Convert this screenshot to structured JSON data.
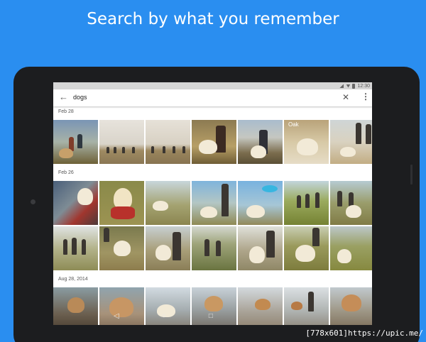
{
  "banner": {
    "title": "Search by what you remember"
  },
  "status_bar": {
    "time": "12:30",
    "icons": [
      "signal-icon",
      "wifi-icon",
      "battery-icon"
    ]
  },
  "search": {
    "query": "dogs",
    "back_icon": "arrow-back-icon",
    "clear_icon": "close-icon",
    "menu_icon": "more-vert-icon"
  },
  "sections": [
    {
      "date": "Feb 28",
      "photos": [
        "hikers-with-dog",
        "group-on-hillside",
        "group-on-hillside-2",
        "woman-with-dog",
        "man-with-dog-hill",
        "dog-at-oak",
        "dogs-running"
      ],
      "overlay_label": "Oak"
    },
    {
      "date": "Feb 26",
      "photos": [
        "dog-with-toy",
        "dog-with-scarf",
        "dog-on-path",
        "man-with-dog",
        "dog-with-frisbee",
        "hikers-on-trail",
        "hikers-with-dog"
      ]
    },
    {
      "date": "",
      "photos": [
        "hikers-walking",
        "dog-on-leash",
        "dog-with-family",
        "family-with-dog",
        "dog-leaping",
        "dog-in-grass",
        "dog-on-path"
      ]
    },
    {
      "date": "Aug 28, 2014",
      "photos": [
        "dog-on-beach",
        "dog-on-sand",
        "beach-dog",
        "dog-on-beach",
        "dog-running-beach",
        "person-with-dog-beach",
        "dog-on-beach"
      ]
    }
  ],
  "nav": {
    "back": "◁",
    "home": "○",
    "recents": "□"
  },
  "watermark": "[778x601]https://upic.me/"
}
